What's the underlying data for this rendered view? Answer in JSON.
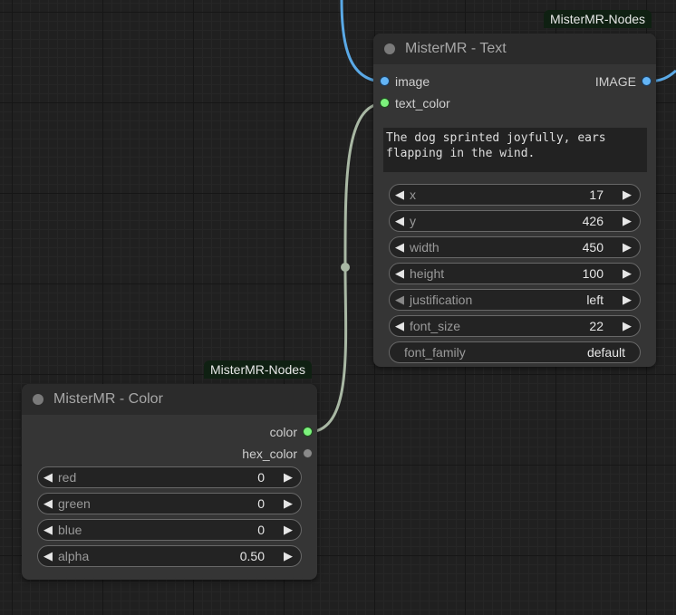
{
  "text_node": {
    "badge": "MisterMR-Nodes",
    "title": "MisterMR - Text",
    "inputs": [
      {
        "label": "image",
        "color": "#64b5f6"
      },
      {
        "label": "text_color",
        "color": "#7cf27c"
      }
    ],
    "output": {
      "label": "IMAGE",
      "color": "#64b5f6"
    },
    "text": "The dog sprinted joyfully, ears\nflapping in the wind.",
    "widgets": [
      {
        "name": "x",
        "value": "17"
      },
      {
        "name": "y",
        "value": "426"
      },
      {
        "name": "width",
        "value": "450"
      },
      {
        "name": "height",
        "value": "100"
      },
      {
        "name": "justification",
        "value": "left"
      },
      {
        "name": "font_size",
        "value": "22"
      },
      {
        "name": "font_family",
        "value": "default"
      }
    ]
  },
  "color_node": {
    "badge": "MisterMR-Nodes",
    "title": "MisterMR - Color",
    "outputs": [
      {
        "label": "color",
        "color": "#7cf27c"
      },
      {
        "label": "hex_color",
        "color": "#8a8a8a"
      }
    ],
    "widgets": [
      {
        "name": "red",
        "value": "0"
      },
      {
        "name": "green",
        "value": "0"
      },
      {
        "name": "blue",
        "value": "0"
      },
      {
        "name": "alpha",
        "value": "0.50"
      }
    ]
  },
  "links": {
    "image_link_color": "#5aa9e6",
    "color_link_color": "#a9b8a4"
  },
  "icons": {
    "decrement": "◀",
    "increment": "▶"
  }
}
